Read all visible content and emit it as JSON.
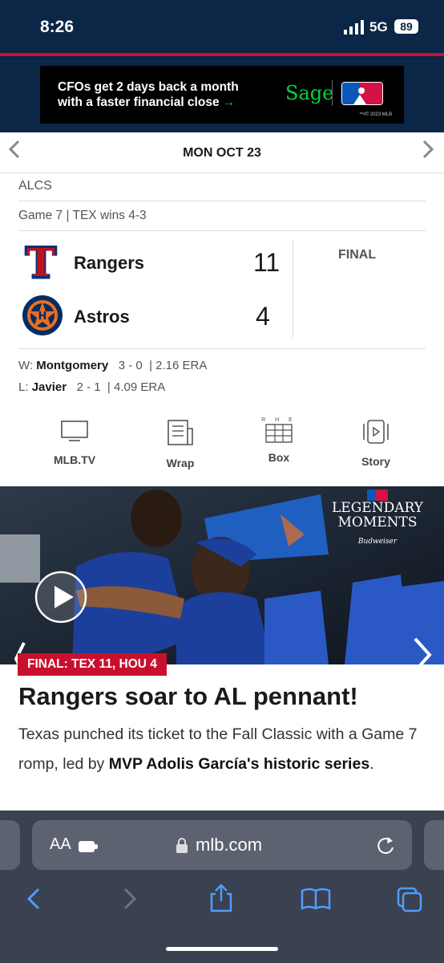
{
  "status_bar": {
    "time": "8:26",
    "network": "5G",
    "battery": "89"
  },
  "ad": {
    "line1": "CFOs get 2 days back a month",
    "line2": "with a faster financial close",
    "arrow": "→",
    "brand": "Sage",
    "fineprint": "™/© 2023 MLB"
  },
  "date_nav": {
    "date": "MON OCT 23",
    "prev_icon": "chevron-left-icon",
    "next_icon": "chevron-right-icon"
  },
  "game": {
    "series": "ALCS",
    "info": "Game 7 | TEX wins 4-3",
    "status": "FINAL",
    "teams": [
      {
        "name": "Rangers",
        "score": "11",
        "logo_letter": "T",
        "color": "#c0111f"
      },
      {
        "name": "Astros",
        "score": "4",
        "logo_letter": "H",
        "color": "#eb6e1f"
      }
    ],
    "winning_pitcher": {
      "prefix": "W:",
      "name": "Montgomery",
      "record": "3 - 0",
      "era": "2.16 ERA"
    },
    "losing_pitcher": {
      "prefix": "L:",
      "name": "Javier",
      "record": "2 - 1",
      "era": "4.09 ERA"
    }
  },
  "action_nav": [
    {
      "label": "MLB.TV",
      "icon": "tv-icon"
    },
    {
      "label": "Wrap",
      "icon": "article-icon"
    },
    {
      "label": "Box",
      "icon": "box-score-icon",
      "icon_text": "R H E"
    },
    {
      "label": "Story",
      "icon": "story-icon"
    }
  ],
  "hero": {
    "brand_title_1": "LEGENDARY",
    "brand_title_2": "MOMENTS",
    "sponsor": "Budweiser",
    "badge": "FINAL: TEX 11, HOU 4",
    "headline": "Rangers soar to AL pennant!",
    "summary_pre": "Texas punched its ticket to the Fall Classic with a Game 7 romp, led by ",
    "summary_bold": "MVP Adolis García's historic series",
    "summary_post": "."
  },
  "browser": {
    "aa": "AA",
    "url": "mlb.com"
  },
  "colors": {
    "navy": "#0b2646",
    "red": "#c8102e",
    "toolbar_blue": "#4f9dff"
  }
}
